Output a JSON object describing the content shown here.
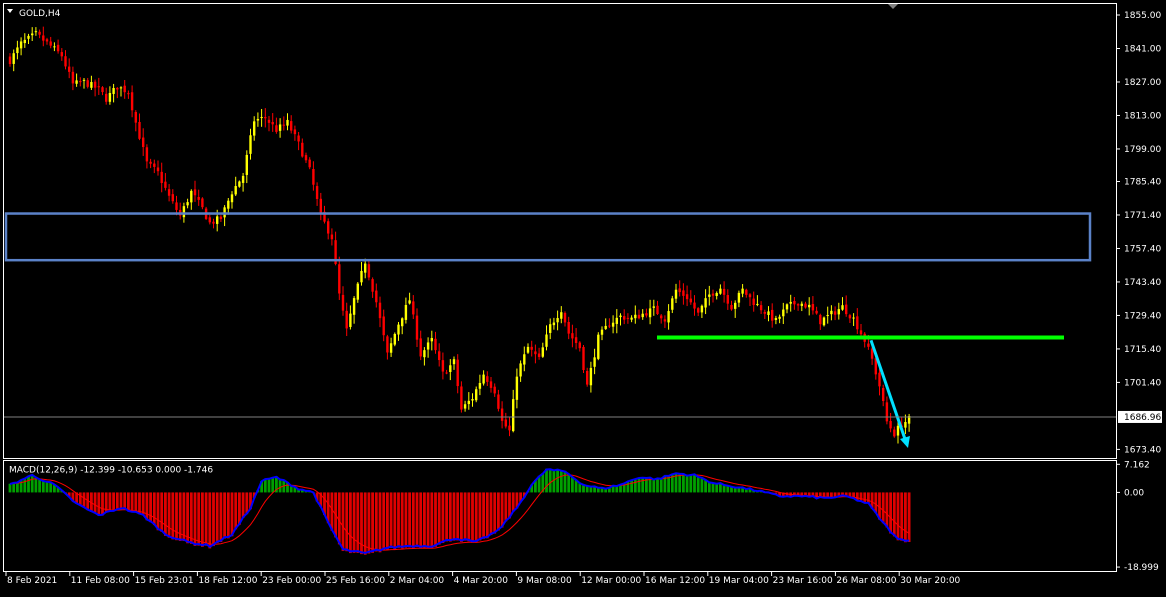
{
  "chart_data": [
    {
      "type": "candlestick",
      "title": "GOLD,H4",
      "x_tick_labels": [
        "8 Feb 2021",
        "11 Feb 08:00",
        "15 Feb 23:01",
        "18 Feb 12:00",
        "23 Feb 00:00",
        "25 Feb 16:00",
        "2 Mar 04:00",
        "4 Mar 20:00",
        "9 Mar 08:00",
        "12 Mar 00:00",
        "16 Mar 12:00",
        "19 Mar 04:00",
        "23 Mar 16:00",
        "26 Mar 08:00",
        "30 Mar 20:00"
      ],
      "y_tick_labels": [
        "1855.00",
        "1841.00",
        "1827.00",
        "1813.00",
        "1799.00",
        "1785.40",
        "1771.40",
        "1757.40",
        "1743.40",
        "1729.40",
        "1715.40",
        "1701.40",
        "1673.40"
      ],
      "ylim": [
        1669.8,
        1859.6
      ],
      "current_price": 1686.96,
      "current_price_label": "1686.96",
      "anchors": [
        [
          0,
          1836
        ],
        [
          3,
          1843
        ],
        [
          7,
          1847
        ],
        [
          11,
          1842
        ],
        [
          14,
          1838
        ],
        [
          17,
          1826
        ],
        [
          20,
          1827
        ],
        [
          24,
          1824
        ],
        [
          26,
          1820
        ],
        [
          29,
          1825
        ],
        [
          32,
          1823
        ],
        [
          34,
          1810
        ],
        [
          37,
          1793
        ],
        [
          40,
          1789
        ],
        [
          43,
          1779
        ],
        [
          46,
          1771
        ],
        [
          49,
          1781
        ],
        [
          52,
          1774
        ],
        [
          54,
          1768
        ],
        [
          57,
          1770
        ],
        [
          60,
          1781
        ],
        [
          63,
          1788
        ],
        [
          66,
          1811
        ],
        [
          69,
          1812
        ],
        [
          72,
          1807
        ],
        [
          75,
          1810
        ],
        [
          78,
          1801
        ],
        [
          81,
          1790
        ],
        [
          84,
          1771
        ],
        [
          87,
          1762
        ],
        [
          89,
          1738
        ],
        [
          91,
          1723
        ],
        [
          93,
          1736
        ],
        [
          96,
          1752
        ],
        [
          99,
          1735
        ],
        [
          102,
          1713
        ],
        [
          105,
          1726
        ],
        [
          108,
          1736
        ],
        [
          111,
          1713
        ],
        [
          114,
          1719
        ],
        [
          117,
          1705
        ],
        [
          120,
          1710
        ],
        [
          122,
          1690
        ],
        [
          125,
          1695
        ],
        [
          128,
          1705
        ],
        [
          131,
          1698
        ],
        [
          133,
          1685
        ],
        [
          135,
          1681
        ],
        [
          137,
          1705
        ],
        [
          140,
          1716
        ],
        [
          143,
          1711
        ],
        [
          146,
          1725
        ],
        [
          149,
          1732
        ],
        [
          151,
          1722
        ],
        [
          154,
          1716
        ],
        [
          156,
          1700
        ],
        [
          159,
          1720
        ],
        [
          162,
          1726
        ],
        [
          165,
          1729
        ],
        [
          168,
          1728
        ],
        [
          171,
          1730
        ],
        [
          174,
          1732
        ],
        [
          177,
          1728
        ],
        [
          180,
          1740
        ],
        [
          183,
          1737
        ],
        [
          186,
          1730
        ],
        [
          189,
          1738
        ],
        [
          192,
          1741
        ],
        [
          195,
          1733
        ],
        [
          198,
          1740
        ],
        [
          201,
          1735
        ],
        [
          204,
          1731
        ],
        [
          207,
          1727
        ],
        [
          210,
          1733
        ],
        [
          213,
          1735
        ],
        [
          216,
          1733
        ],
        [
          219,
          1727
        ],
        [
          222,
          1730
        ],
        [
          225,
          1733
        ],
        [
          228,
          1728
        ],
        [
          231,
          1719
        ],
        [
          233,
          1711
        ],
        [
          235,
          1700
        ],
        [
          237,
          1685
        ],
        [
          239,
          1680
        ],
        [
          241,
          1684
        ],
        [
          243,
          1686
        ]
      ],
      "annotations": [
        {
          "type": "rectangle",
          "label": "resistance zone",
          "price_top": 1772.0,
          "price_bottom": 1752.5,
          "color": "#5b82c8"
        },
        {
          "type": "horizontal-line",
          "label": "support line",
          "price": 1720.2,
          "from_bar": 165,
          "to_bar": 285,
          "color": "#00ff00"
        },
        {
          "type": "arrow",
          "label": "downtrend arrow",
          "from": [
            232,
            1719
          ],
          "to": [
            241,
            1674
          ],
          "color": "#00e0ff"
        }
      ],
      "colors": {
        "bull": "#ffff00",
        "bear": "#ff0000",
        "grid": "#ffffff",
        "background": "#000000"
      }
    },
    {
      "type": "histogram+line",
      "title": "MACD(12,26,9) -12.399 -10.653 0.000 -1.746",
      "y_tick_labels": [
        "7.162",
        "0.00",
        "-18.999"
      ],
      "ylim": [
        -20.0,
        8.0
      ],
      "series": [
        {
          "name": "MACD",
          "kind": "histogram",
          "color_pos": "#00a000",
          "color_neg": "#e00000"
        },
        {
          "name": "MACD line",
          "kind": "line",
          "color": "#0000ff"
        },
        {
          "name": "Signal",
          "kind": "line",
          "color": "#ff0000"
        }
      ],
      "anchors": [
        [
          0,
          2
        ],
        [
          6,
          4.5
        ],
        [
          12,
          2
        ],
        [
          18,
          -3
        ],
        [
          24,
          -6
        ],
        [
          30,
          -4
        ],
        [
          36,
          -6
        ],
        [
          42,
          -11
        ],
        [
          48,
          -13
        ],
        [
          54,
          -14
        ],
        [
          60,
          -11
        ],
        [
          65,
          -4
        ],
        [
          68,
          3
        ],
        [
          72,
          4
        ],
        [
          78,
          1
        ],
        [
          82,
          0
        ],
        [
          86,
          -8
        ],
        [
          90,
          -15
        ],
        [
          96,
          -16
        ],
        [
          102,
          -14.5
        ],
        [
          108,
          -14
        ],
        [
          114,
          -14
        ],
        [
          120,
          -12
        ],
        [
          126,
          -13
        ],
        [
          132,
          -10
        ],
        [
          137,
          -4
        ],
        [
          141,
          2
        ],
        [
          145,
          6
        ],
        [
          150,
          5.5
        ],
        [
          155,
          2
        ],
        [
          160,
          1
        ],
        [
          165,
          2
        ],
        [
          170,
          4
        ],
        [
          175,
          3.5
        ],
        [
          180,
          5
        ],
        [
          185,
          4.5
        ],
        [
          190,
          2.5
        ],
        [
          196,
          1.5
        ],
        [
          202,
          0.5
        ],
        [
          208,
          -1
        ],
        [
          214,
          -1
        ],
        [
          220,
          -1.5
        ],
        [
          226,
          -1
        ],
        [
          232,
          -3
        ],
        [
          236,
          -8
        ],
        [
          240,
          -12.4
        ],
        [
          243,
          -12.4
        ]
      ],
      "signal_anchor_value": -10.653
    }
  ]
}
